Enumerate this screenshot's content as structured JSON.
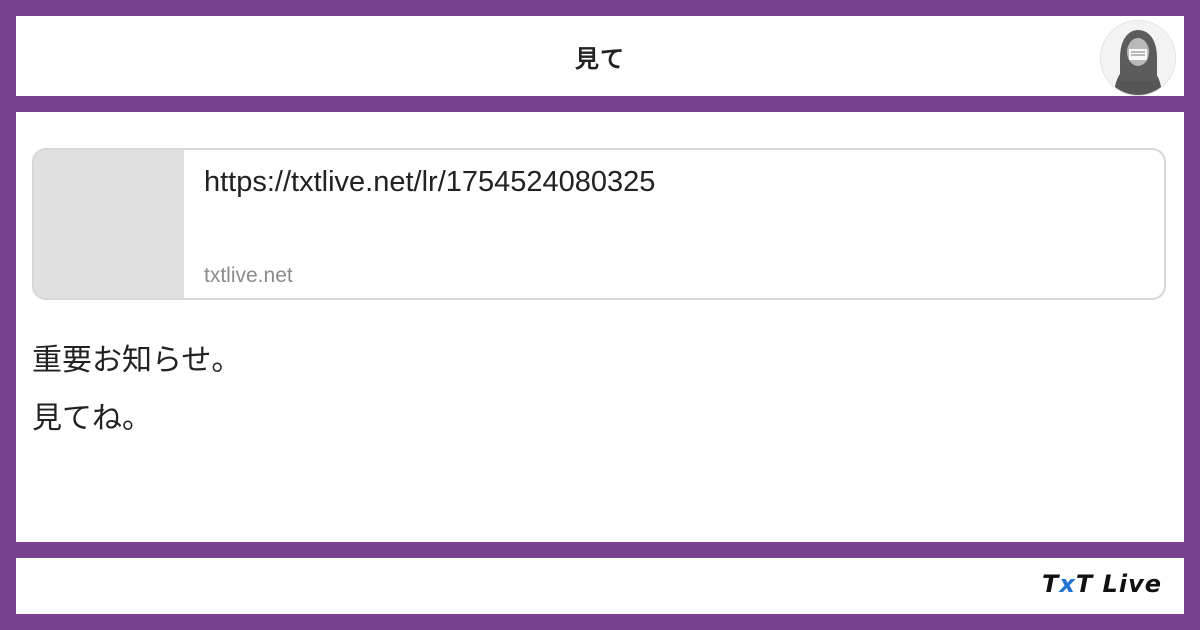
{
  "header": {
    "title": "見て"
  },
  "link_card": {
    "url": "https://txtlive.net/lr/1754524080325",
    "domain": "txtlive.net"
  },
  "message": {
    "line1": "重要お知らせ。",
    "line2": "見てね。"
  },
  "footer": {
    "brand_part1": "T",
    "brand_x": "x",
    "brand_part2": "T Live"
  },
  "colors": {
    "frame": "#78418f",
    "panel": "#ffffff",
    "thumbnail": "#e0e0e0",
    "brand_x": "#1f73d3"
  }
}
